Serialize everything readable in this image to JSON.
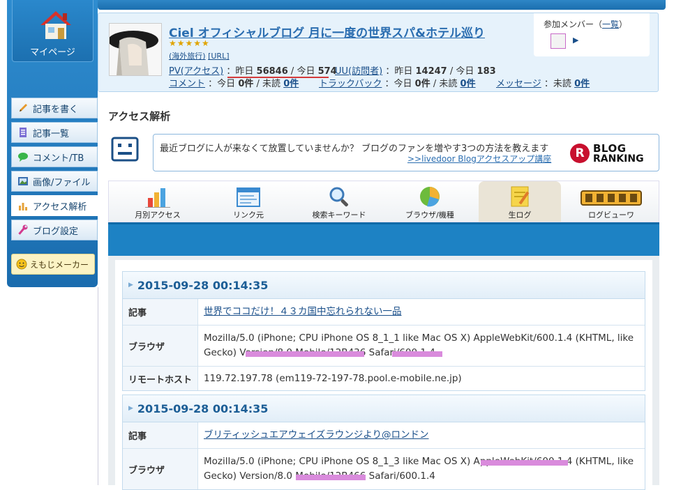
{
  "sidebar": {
    "mypage_label": "マイページ",
    "items": [
      {
        "label": "記事を書く",
        "icon": "pencil-icon"
      },
      {
        "label": "記事一覧",
        "icon": "document-icon"
      },
      {
        "label": "コメント/TB",
        "icon": "speech-bubble-icon"
      },
      {
        "label": "画像/ファイル",
        "icon": "image-icon"
      },
      {
        "label": "アクセス解析",
        "icon": "bar-chart-icon"
      },
      {
        "label": "ブログ設定",
        "icon": "wrench-icon"
      }
    ],
    "emoji_label": "えもじメーカー"
  },
  "blog": {
    "title": "Ciel オフィシャルブログ 月に一度の世界スパ&ホテル巡り",
    "stars": "★★★★★",
    "category": "(海外旅行)",
    "url_label": "[URL]",
    "pv_label": "PV(アクセス)",
    "pv_yesterday_label": "昨日",
    "pv_yesterday": "56846",
    "pv_today_label": "今日",
    "pv_today": "574",
    "uu_label": "UU(訪問者)",
    "uu_yesterday_label": "昨日",
    "uu_yesterday": "14247",
    "uu_today_label": "今日",
    "uu_today": "183",
    "comment_label": "コメント",
    "comment_today_label": "今日",
    "comment_today": "0件",
    "comment_unread_label": "未読",
    "comment_unread": "0件",
    "trackback_label": "トラックバック",
    "trackback_today_label": "今日",
    "trackback_today": "0件",
    "trackback_unread_label": "未読",
    "trackback_unread": "0件",
    "message_label": "メッセージ",
    "message_unread_label": "未読",
    "message_unread": "0件",
    "members_label": "参加メンバー（",
    "members_link": "一覧",
    "members_close": "）"
  },
  "access": {
    "heading": "アクセス解析",
    "notice_text": "最近ブログに人が来なくて放置していませんか？ ブログのファンを増やす3つの方法を教えます",
    "notice_link": ">>livedoor Blogアクセスアップ講座",
    "ranking_w1": "BLOG",
    "ranking_w2": "RANKING",
    "ranking_small": "人気ブログランキング"
  },
  "tabs": [
    {
      "label": "月別アクセス",
      "icon": "bar-chart-icon"
    },
    {
      "label": "リンク元",
      "icon": "window-icon"
    },
    {
      "label": "検索キーワード",
      "icon": "magnifier-icon"
    },
    {
      "label": "ブラウザ/機種",
      "icon": "pie-chart-icon"
    },
    {
      "label": "生ログ",
      "icon": "notepad-icon"
    },
    {
      "label": "ログビューワ",
      "icon": "log-viewer-logo-icon"
    }
  ],
  "selected_tab": "生ログ",
  "entries": [
    {
      "datetime": "2015-09-28 00:14:35",
      "article_label": "記事",
      "article": "世界でココだけ！４３カ国中忘れられない一品",
      "browser_label": "ブラウザ",
      "browser": "Mozilla/5.0 (iPhone; CPU iPhone OS 8_1_1 like Mac OS X) AppleWebKit/600.1.4 (KHTML, like Gecko) Version/8.0 Mobile/12B436 Safari/600.1.4",
      "host_label": "リモートホスト",
      "host": "119.72.197.78 (em119-72-197-78.pool.e-mobile.ne.jp)"
    },
    {
      "datetime": "2015-09-28 00:14:35",
      "article_label": "記事",
      "article": "ブリティッシュエアウェイズラウンジより@ロンドン",
      "browser_label": "ブラウザ",
      "browser": "Mozilla/5.0 (iPhone; CPU iPhone OS 8_1_3 like Mac OS X) AppleWebKit/600.1.4 (KHTML, like Gecko) Version/8.0 Mobile/12B466 Safari/600.1.4"
    }
  ],
  "colors": {
    "accent": "#1d82c4",
    "redaction": "#d98bdc",
    "title_link": "#2a6db0"
  }
}
